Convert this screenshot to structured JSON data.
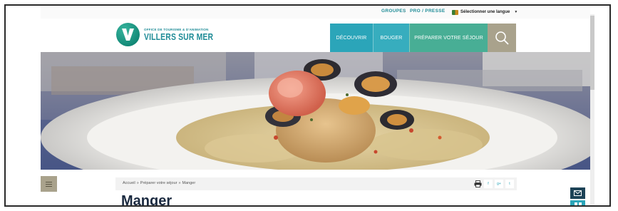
{
  "topbar": {
    "links": [
      "GROUPES",
      "PRO / PRESSE"
    ],
    "language_label": "Sélectionner une langue"
  },
  "logo": {
    "letter": "V",
    "small_text": "OFFICE DE TOURISME & D'ANIMATION",
    "name": "VILLERS SUR MER"
  },
  "nav": {
    "items": [
      "DÉCOUVRIR",
      "BOUGER",
      "PRÉPARER VOTRE SÉJOUR"
    ],
    "search_icon": "search-icon"
  },
  "hero": {
    "alt": "hero-photo"
  },
  "breadcrumb": {
    "items": [
      "Accueil",
      "Préparer votre séjour",
      "Manger"
    ],
    "separator": "»"
  },
  "share": {
    "icons": [
      "print-icon",
      "facebook-icon",
      "google-plus-icon",
      "twitter-icon"
    ],
    "labels": [
      "f",
      "g+",
      "t"
    ]
  },
  "page": {
    "title": "Manger"
  },
  "floating": {
    "mail_icon": "mail-icon",
    "social_icons": "social-icons"
  },
  "colors": {
    "teal": "#2ba5b9",
    "green": "#48ae95",
    "sand": "#a9a28c",
    "navy": "#1b2a40"
  }
}
